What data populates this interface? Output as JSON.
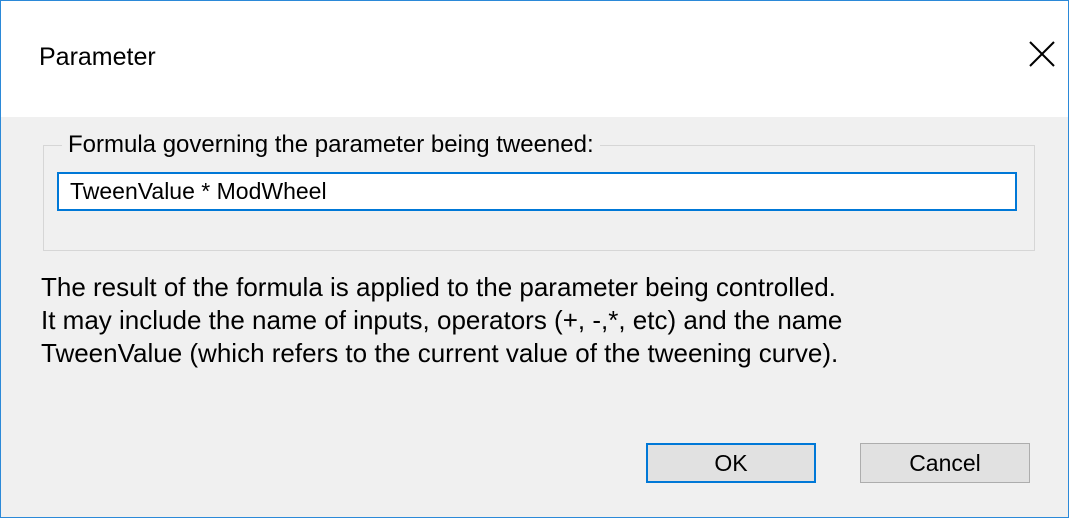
{
  "window": {
    "title": "Parameter",
    "close_icon": "close-icon"
  },
  "formula_group": {
    "label": "Formula governing the parameter being tweened:",
    "value": "TweenValue * ModWheel"
  },
  "help": {
    "line1": "The result of the formula is applied to the parameter being controlled.",
    "line2": "It may include the name of inputs, operators (+, -,*, etc) and the name",
    "line3": "TweenValue (which refers to the current value of the tweening curve)."
  },
  "buttons": {
    "ok_label": "OK",
    "cancel_label": "Cancel"
  },
  "colors": {
    "accent": "#0078d7",
    "window_border": "#2b89d8",
    "dialog_bg": "#f0f0f0",
    "button_bg": "#e1e1e1"
  }
}
